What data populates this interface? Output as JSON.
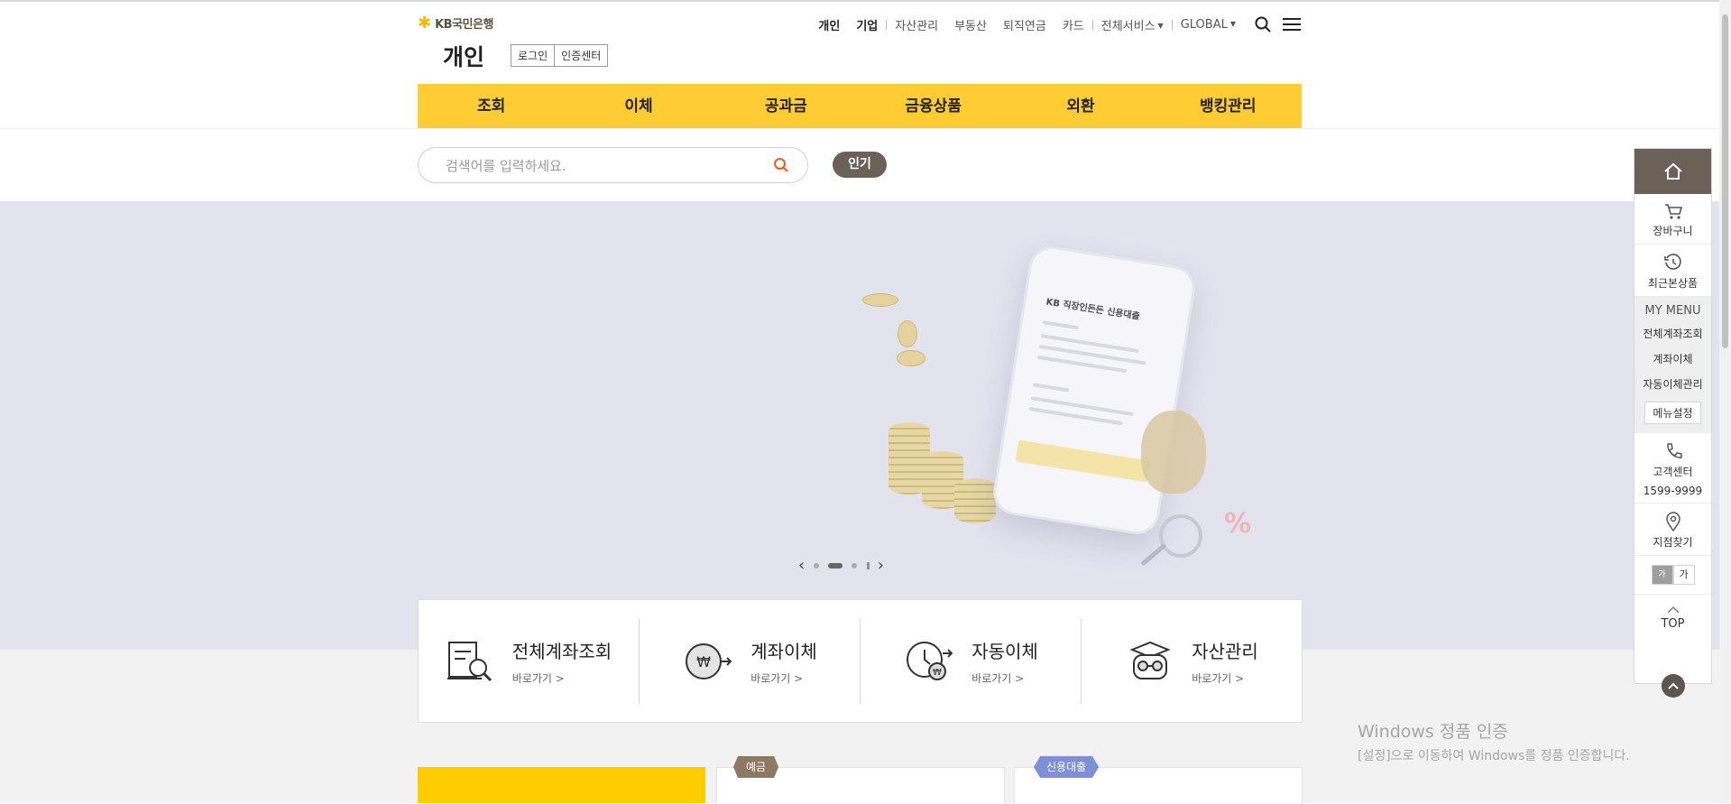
{
  "header": {
    "logo_text": "KB국민은행",
    "page_title": "개인",
    "auth_buttons": [
      "로그인",
      "인증센터"
    ],
    "util_nav": {
      "personal": "개인",
      "corporate": "기업",
      "links": [
        "자산관리",
        "부동산",
        "퇴직연금",
        "카드"
      ],
      "all_services": "전체서비스",
      "global": "GLOBAL"
    },
    "icons": {
      "search": "search-icon",
      "menu": "hamburger-menu-icon"
    }
  },
  "gnb": [
    "조회",
    "이체",
    "공과금",
    "금융상품",
    "외환",
    "뱅킹관리"
  ],
  "search": {
    "placeholder": "검색어를 입력하세요.",
    "popular_label": "인기"
  },
  "hero": {
    "phone_title": "KB 직장인든든 신용대출",
    "controls": {
      "prev": "‹",
      "next": "›",
      "pause": "II",
      "active_slide": 2,
      "total_slides": 3
    }
  },
  "quick_menu": [
    {
      "title": "전체계좌조회",
      "link": "바로가기 >",
      "icon": "account-inquiry-icon"
    },
    {
      "title": "계좌이체",
      "link": "바로가기 >",
      "icon": "won-transfer-icon"
    },
    {
      "title": "자동이체",
      "link": "바로가기 >",
      "icon": "auto-transfer-icon"
    },
    {
      "title": "자산관리",
      "link": "바로가기 >",
      "icon": "asset-management-icon"
    }
  ],
  "cards": {
    "deposit_tag": "예금",
    "loan_tag": "신용대출"
  },
  "quickbar": {
    "home_icon": "home-icon",
    "cart": "장바구니",
    "recent": "최근본상품",
    "my_menu_title": "MY MENU",
    "my_menu_items": [
      "전체계좌조회",
      "계좌이체",
      "자동이체관리"
    ],
    "menu_settings": "메뉴설정",
    "customer_center": "고객센터",
    "phone": "1599-9999",
    "branch": "지점찾기",
    "font_small": "가",
    "font_large": "가",
    "top": "TOP"
  },
  "windows_notice": {
    "title": "Windows 정품 인증",
    "message": "[설정]으로 이동하여 Windows를 정품 인증합니다."
  },
  "colors": {
    "brand_yellow": "#ffcd33",
    "brand_brown": "#6b6158",
    "hero_bg": "#e3e3ee"
  }
}
